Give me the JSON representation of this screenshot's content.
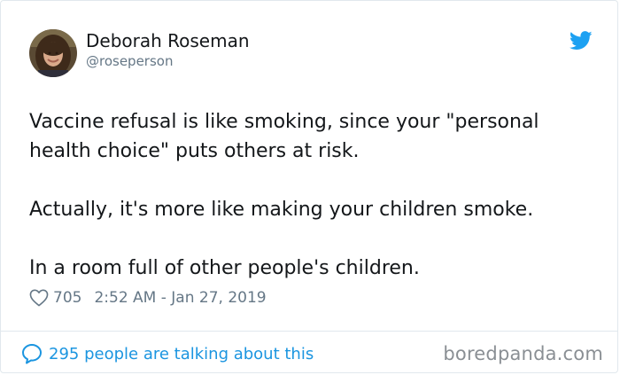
{
  "tweet": {
    "author": {
      "display_name": "Deborah Roseman",
      "handle": "@roseperson",
      "avatar_icon": "profile-photo"
    },
    "platform_icon": "twitter-bird-icon",
    "accent_color": "#1b95e0",
    "paragraphs": [
      "Vaccine refusal is like smoking, since your \"personal health choice\" puts others at risk.",
      "Actually, it's more like making your children smoke.",
      "In a room full of other people's children."
    ],
    "likes": "705",
    "timestamp": "2:52 AM - Jan 27, 2019",
    "conversation_label": "295 people are talking about this"
  },
  "watermark": "boredpanda.com"
}
